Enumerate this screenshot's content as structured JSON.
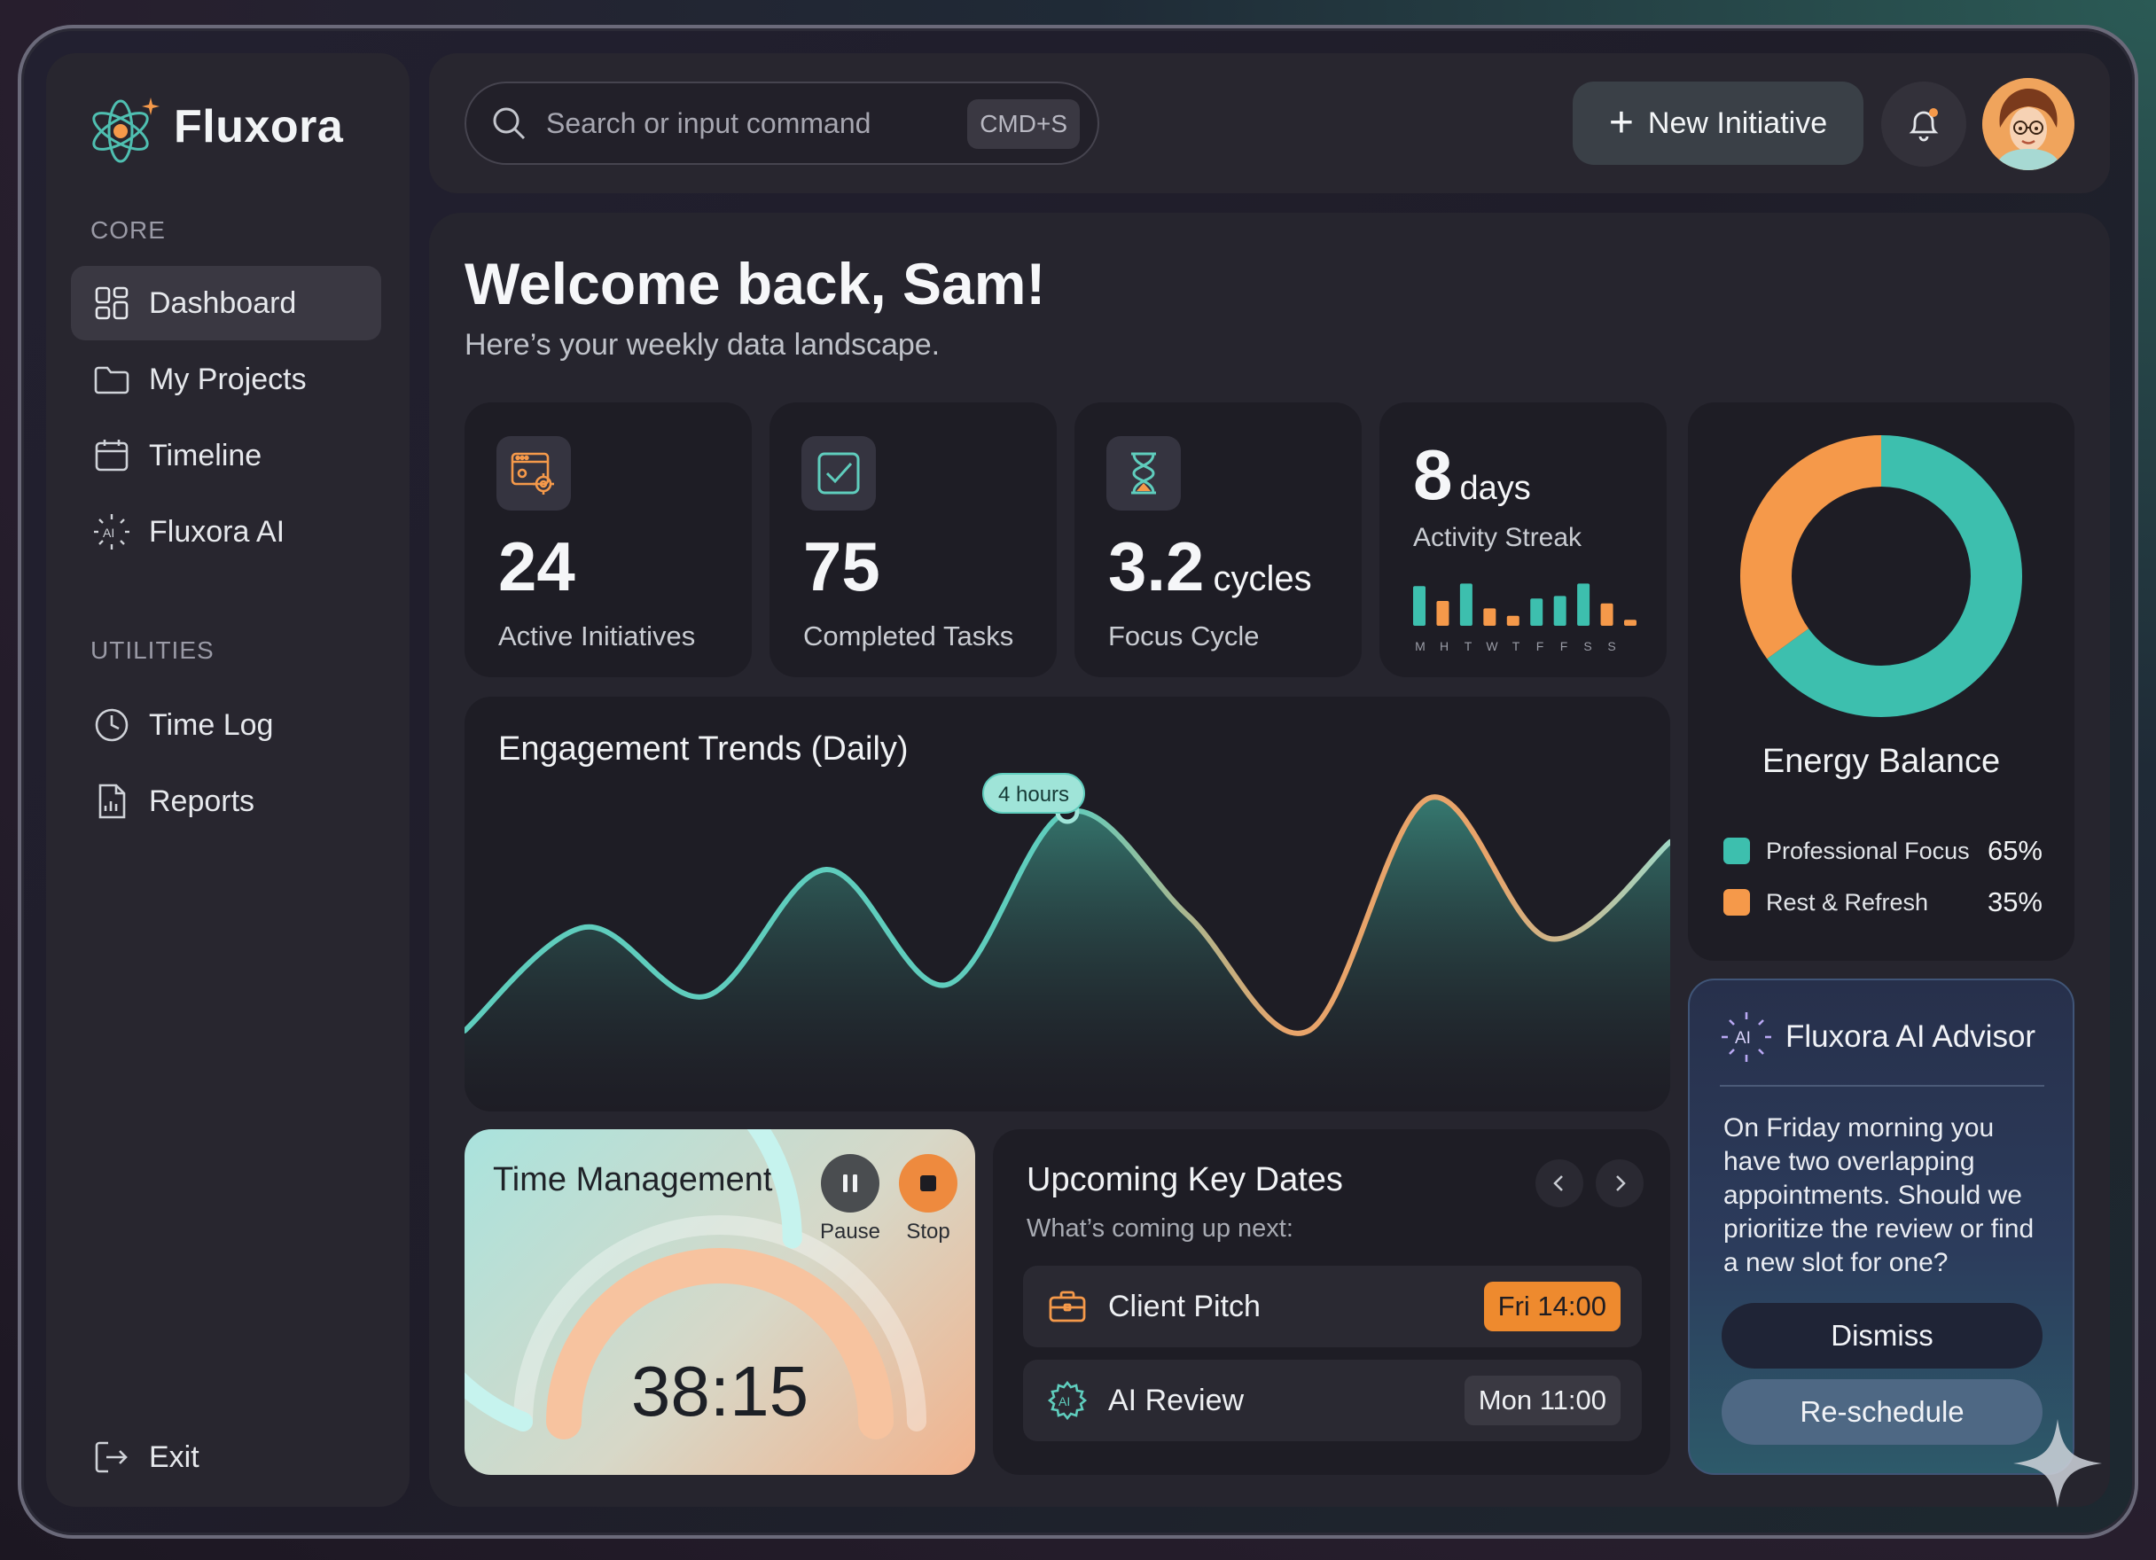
{
  "app": {
    "name": "Fluxora"
  },
  "sidebar": {
    "core_label": "CORE",
    "core_items": [
      {
        "label": "Dashboard",
        "icon": "dashboard-icon",
        "active": true
      },
      {
        "label": "My Projects",
        "icon": "folder-icon"
      },
      {
        "label": "Timeline",
        "icon": "calendar-icon"
      },
      {
        "label": "Fluxora AI",
        "icon": "ai-sparkle-icon"
      }
    ],
    "utilities_label": "UTILITIES",
    "utility_items": [
      {
        "label": "Time Log",
        "icon": "clock-icon"
      },
      {
        "label": "Reports",
        "icon": "report-icon"
      }
    ],
    "exit_label": "Exit"
  },
  "topbar": {
    "search_placeholder": "Search or input command",
    "search_shortcut": "CMD+S",
    "new_button": "New Initiative",
    "notification_dot": true
  },
  "main": {
    "welcome": "Welcome back, Sam!",
    "subtitle": "Here’s your weekly data landscape."
  },
  "stats": [
    {
      "value": "24",
      "label": "Active Initiatives",
      "icon": "settings-window-icon"
    },
    {
      "value": "75",
      "label": "Completed Tasks",
      "icon": "checkbox-icon"
    },
    {
      "value": "3.2",
      "unit": "cycles",
      "label": "Focus Cycle",
      "icon": "hourglass-icon"
    }
  ],
  "streak": {
    "value": "8",
    "unit": "days",
    "label": "Activity Streak",
    "days": [
      "M",
      "H",
      "T",
      "W",
      "T",
      "F",
      "F",
      "S",
      "S"
    ],
    "bars": [
      0.8,
      0.5,
      0.85,
      0.35,
      0.2,
      0.55,
      0.6,
      0.85,
      0.45,
      0.12
    ],
    "bar_colors": [
      "#3dbfae",
      "#f5994a",
      "#3dbfae",
      "#f5994a",
      "#f5994a",
      "#3dbfae",
      "#3dbfae",
      "#3dbfae",
      "#f5994a",
      "#f5994a"
    ]
  },
  "energy": {
    "title": "Energy Balance",
    "segments": [
      {
        "label": "Professional Focus",
        "value": 65,
        "pct": "65%",
        "color": "#3dbfae"
      },
      {
        "label": "Rest & Refresh",
        "value": 35,
        "pct": "35%",
        "color": "#f5994a"
      }
    ]
  },
  "chart_data": {
    "type": "area",
    "title": "Engagement Trends (Daily)",
    "annotation": "4 hours",
    "values": [
      0.05,
      0.5,
      0.2,
      0.75,
      0.25,
      1.0,
      0.55,
      0.05,
      1.06,
      0.45,
      0.87
    ],
    "colors": {
      "primary": "#5fcdbd",
      "secondary": "#e8a46a"
    }
  },
  "timer": {
    "title": "Time Management",
    "pause_label": "Pause",
    "stop_label": "Stop",
    "time": "38:15",
    "progress": 0.62
  },
  "dates": {
    "title": "Upcoming Key Dates",
    "subtitle": "What’s coming up next:",
    "items": [
      {
        "name": "Client Pitch",
        "when": "Fri 14:00",
        "icon": "briefcase-icon",
        "highlight": true
      },
      {
        "name": "AI Review",
        "when": "Mon 11:00",
        "icon": "ai-gear-icon",
        "highlight": false
      }
    ]
  },
  "advisor": {
    "title": "Fluxora AI Advisor",
    "message": "On Friday morning you have two overlapping appointments. Should we prioritize the review or find a new slot for one?",
    "dismiss": "Dismiss",
    "reschedule": "Re-schedule"
  }
}
